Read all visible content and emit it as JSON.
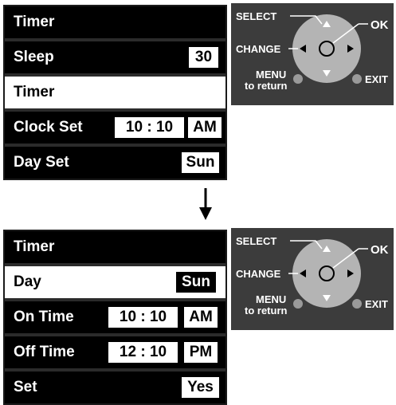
{
  "panel1": {
    "rows": [
      {
        "label": "Timer",
        "values": []
      },
      {
        "label": "Sleep",
        "values": [
          "30"
        ]
      },
      {
        "label": "Timer",
        "values": []
      },
      {
        "label": "Clock Set",
        "values": [
          "10 : 10",
          "AM"
        ]
      },
      {
        "label": "Day Set",
        "values": [
          "Sun"
        ]
      }
    ]
  },
  "panel2": {
    "rows": [
      {
        "label": "Timer",
        "values": []
      },
      {
        "label": "Day",
        "values": [
          "Sun"
        ]
      },
      {
        "label": "On Time",
        "values": [
          "10 : 10",
          "AM"
        ]
      },
      {
        "label": "Off Time",
        "values": [
          "12 : 10",
          "PM"
        ]
      },
      {
        "label": "Set",
        "values": [
          "Yes"
        ]
      }
    ]
  },
  "remote": {
    "select": "SELECT",
    "ok": "OK",
    "change": "CHANGE",
    "menu": "MENU",
    "to_return": "to return",
    "exit": "EXIT"
  },
  "colors": {
    "row_bg": "#000000",
    "highlight_bg": "#ffffff",
    "remote_bg": "#3c3c3c",
    "pad_fill": "#b4b4b4",
    "button_fill": "#9a9a9a"
  }
}
